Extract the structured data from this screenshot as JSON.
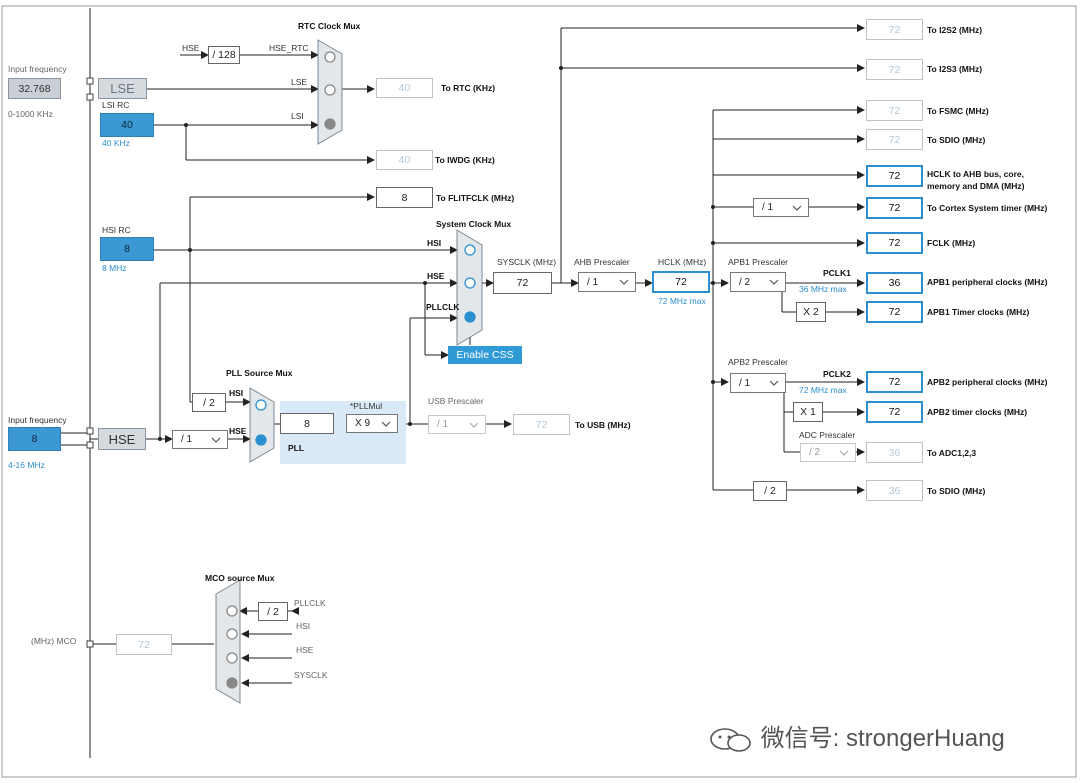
{
  "rtc_mux": {
    "title": "RTC Clock Mux",
    "in_hse_label": "HSE",
    "div": "/ 128",
    "hse_rtc": "HSE_RTC",
    "lse": "LSE",
    "lsi": "LSI",
    "out_value": "40",
    "out_label": "To RTC (KHz)"
  },
  "lse_input": {
    "label": "Input frequency",
    "value": "32.768",
    "range": "0-1000 KHz",
    "block": "LSE"
  },
  "lsi_rc": {
    "label": "LSI RC",
    "value": "40",
    "freq": "40 KHz"
  },
  "iwdg": {
    "value": "40",
    "label": "To IWDG (KHz)"
  },
  "flitf": {
    "value": "8",
    "label": "To FLITFCLK (MHz)"
  },
  "hsi_rc": {
    "label": "HSI RC",
    "value": "8",
    "freq": "8 MHz"
  },
  "sysclk_mux": {
    "title": "System Clock Mux",
    "hsi": "HSI",
    "hse": "HSE",
    "pllclk": "PLLCLK",
    "enable_css": "Enable CSS"
  },
  "sysclk": {
    "label": "SYSCLK (MHz)",
    "value": "72"
  },
  "ahb": {
    "label": "AHB Prescaler",
    "value": "/ 1"
  },
  "hclk": {
    "label": "HCLK (MHz)",
    "value": "72",
    "max": "72 MHz max"
  },
  "i2s2": {
    "value": "72",
    "label": "To I2S2 (MHz)"
  },
  "i2s3": {
    "value": "72",
    "label": "To I2S3 (MHz)"
  },
  "fsmc": {
    "value": "72",
    "label": "To FSMC (MHz)"
  },
  "sdio1": {
    "value": "72",
    "label": "To SDIO (MHz)"
  },
  "hclk_out": {
    "value": "72",
    "label1": "HCLK to AHB bus, core,",
    "label2": "memory and DMA (MHz)"
  },
  "cortex": {
    "div": "/ 1",
    "value": "72",
    "label": "To Cortex System timer (MHz)"
  },
  "fclk": {
    "value": "72",
    "label": "FCLK (MHz)"
  },
  "apb1": {
    "label": "APB1 Prescaler",
    "value": "/ 2",
    "pclk": "PCLK1",
    "max": "36 MHz max",
    "periph_value": "36",
    "periph_label": "APB1 peripheral clocks (MHz)",
    "mult": "X 2",
    "timer_value": "72",
    "timer_label": "APB1 Timer clocks (MHz)"
  },
  "apb2": {
    "label": "APB2 Prescaler",
    "value": "/ 1",
    "pclk": "PCLK2",
    "max": "72 MHz max",
    "periph_value": "72",
    "periph_label": "APB2 peripheral clocks (MHz)",
    "mult": "X 1",
    "timer_value": "72",
    "timer_label": "APB2 timer clocks (MHz)"
  },
  "adc": {
    "label": "ADC Prescaler",
    "value": "/ 2",
    "out_value": "36",
    "out_label": "To ADC1,2,3"
  },
  "sdio2": {
    "div": "/ 2",
    "value": "36",
    "label": "To SDIO (MHz)"
  },
  "hse_input": {
    "label": "Input frequency",
    "value": "8",
    "range": "4-16 MHz",
    "block": "HSE",
    "div": "/ 1"
  },
  "pll_mux": {
    "title": "PLL Source Mux",
    "div": "/ 2",
    "hsi": "HSI",
    "hse": "HSE",
    "pll_in": "8",
    "pll_label": "PLL",
    "mul_label": "*PLLMul",
    "mul_value": "X 9"
  },
  "usb": {
    "label": "USB Prescaler",
    "value": "/ 1",
    "out_value": "72",
    "out_label": "To USB (MHz)"
  },
  "mco": {
    "title": "MCO source Mux",
    "label": "(MHz) MCO",
    "value": "72",
    "div": "/ 2",
    "pllclk": "PLLCLK",
    "hsi": "HSI",
    "hse": "HSE",
    "sysclk": "SYSCLK"
  },
  "watermark": "微信号: strongerHuang",
  "colors": {
    "accent": "#2b8fd0",
    "fill": "#3b98d3",
    "grey_block": "#d5dade",
    "pll_bg": "#d9e9f7"
  }
}
